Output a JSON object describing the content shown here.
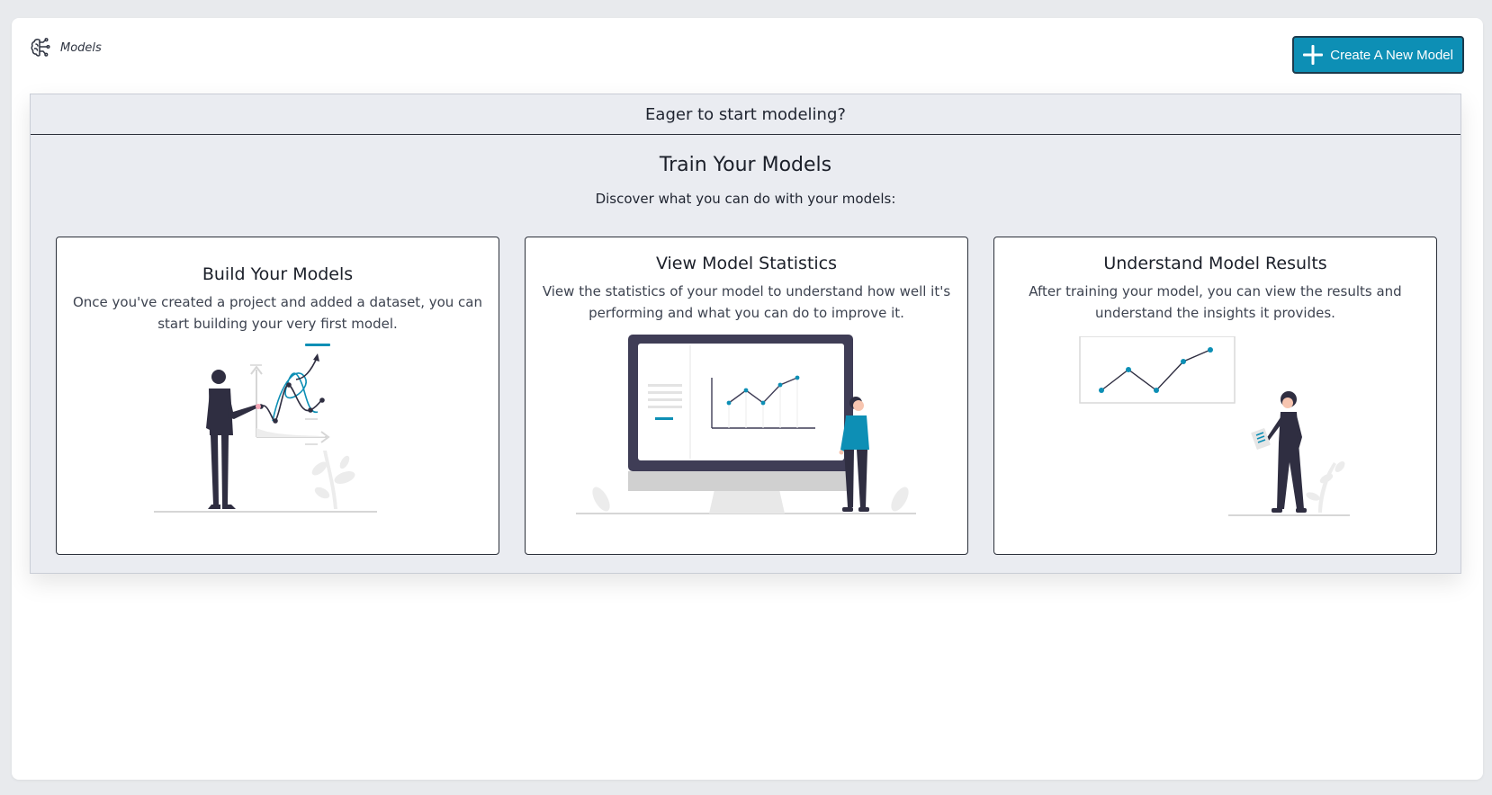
{
  "header": {
    "breadcrumb_label": "Models",
    "create_button_label": "Create A New Model"
  },
  "panel": {
    "header": "Eager to start modeling?",
    "title": "Train Your Models",
    "subtitle": "Discover what you can do with your models:"
  },
  "cards": [
    {
      "title": "Build Your Models",
      "description": "Once you've created a project and added a dataset, you can start building your very first model."
    },
    {
      "title": "View Model Statistics",
      "description": "View the statistics of your model to understand how well it's performing and what you can do to improve it."
    },
    {
      "title": "Understand Model Results",
      "description": "After training your model, you can view the results and understand the insights it provides."
    }
  ],
  "colors": {
    "accent": "#0d8fb5",
    "panel_bg": "#eaecf1",
    "dark": "#2f2e41"
  },
  "icons": {
    "breadcrumb": "brain-circuit-icon",
    "create": "plus-icon"
  }
}
